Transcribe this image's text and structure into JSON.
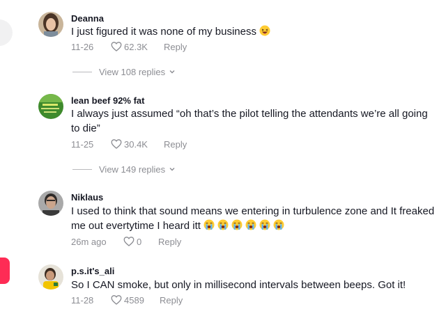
{
  "comments": [
    {
      "username": "Deanna",
      "text": "I just figured it was none of my business",
      "date": "11-26",
      "likes": "62.3K",
      "reply_label": "Reply",
      "view_replies": "View 108 replies"
    },
    {
      "username": "lean beef 92% fat",
      "text": "I always just assumed “oh that’s the pilot telling the attendants we’re all going to die”",
      "date": "11-25",
      "likes": "30.4K",
      "reply_label": "Reply",
      "view_replies": "View 149 replies"
    },
    {
      "username": "Niklaus",
      "text": "I used to think that sound means we entering in turbulence zone and It freaked me out evertytime I heard itt",
      "date": "26m ago",
      "likes": "0",
      "reply_label": "Reply"
    },
    {
      "username": "p.s.it's_ali",
      "text": "So I CAN smoke, but only in millisecond intervals between beeps. Got it!",
      "date": "11-28",
      "likes": "4589",
      "reply_label": "Reply"
    }
  ],
  "icons": {
    "like": "heart-outline-icon",
    "expand": "chevron-down-icon",
    "emoji_laugh": "grinning-squinting-emoji",
    "emoji_cry": "loudly-crying-emoji"
  },
  "colors": {
    "text_primary": "#161823",
    "text_secondary": "#8a8b91",
    "accent": "#fe2c55"
  }
}
